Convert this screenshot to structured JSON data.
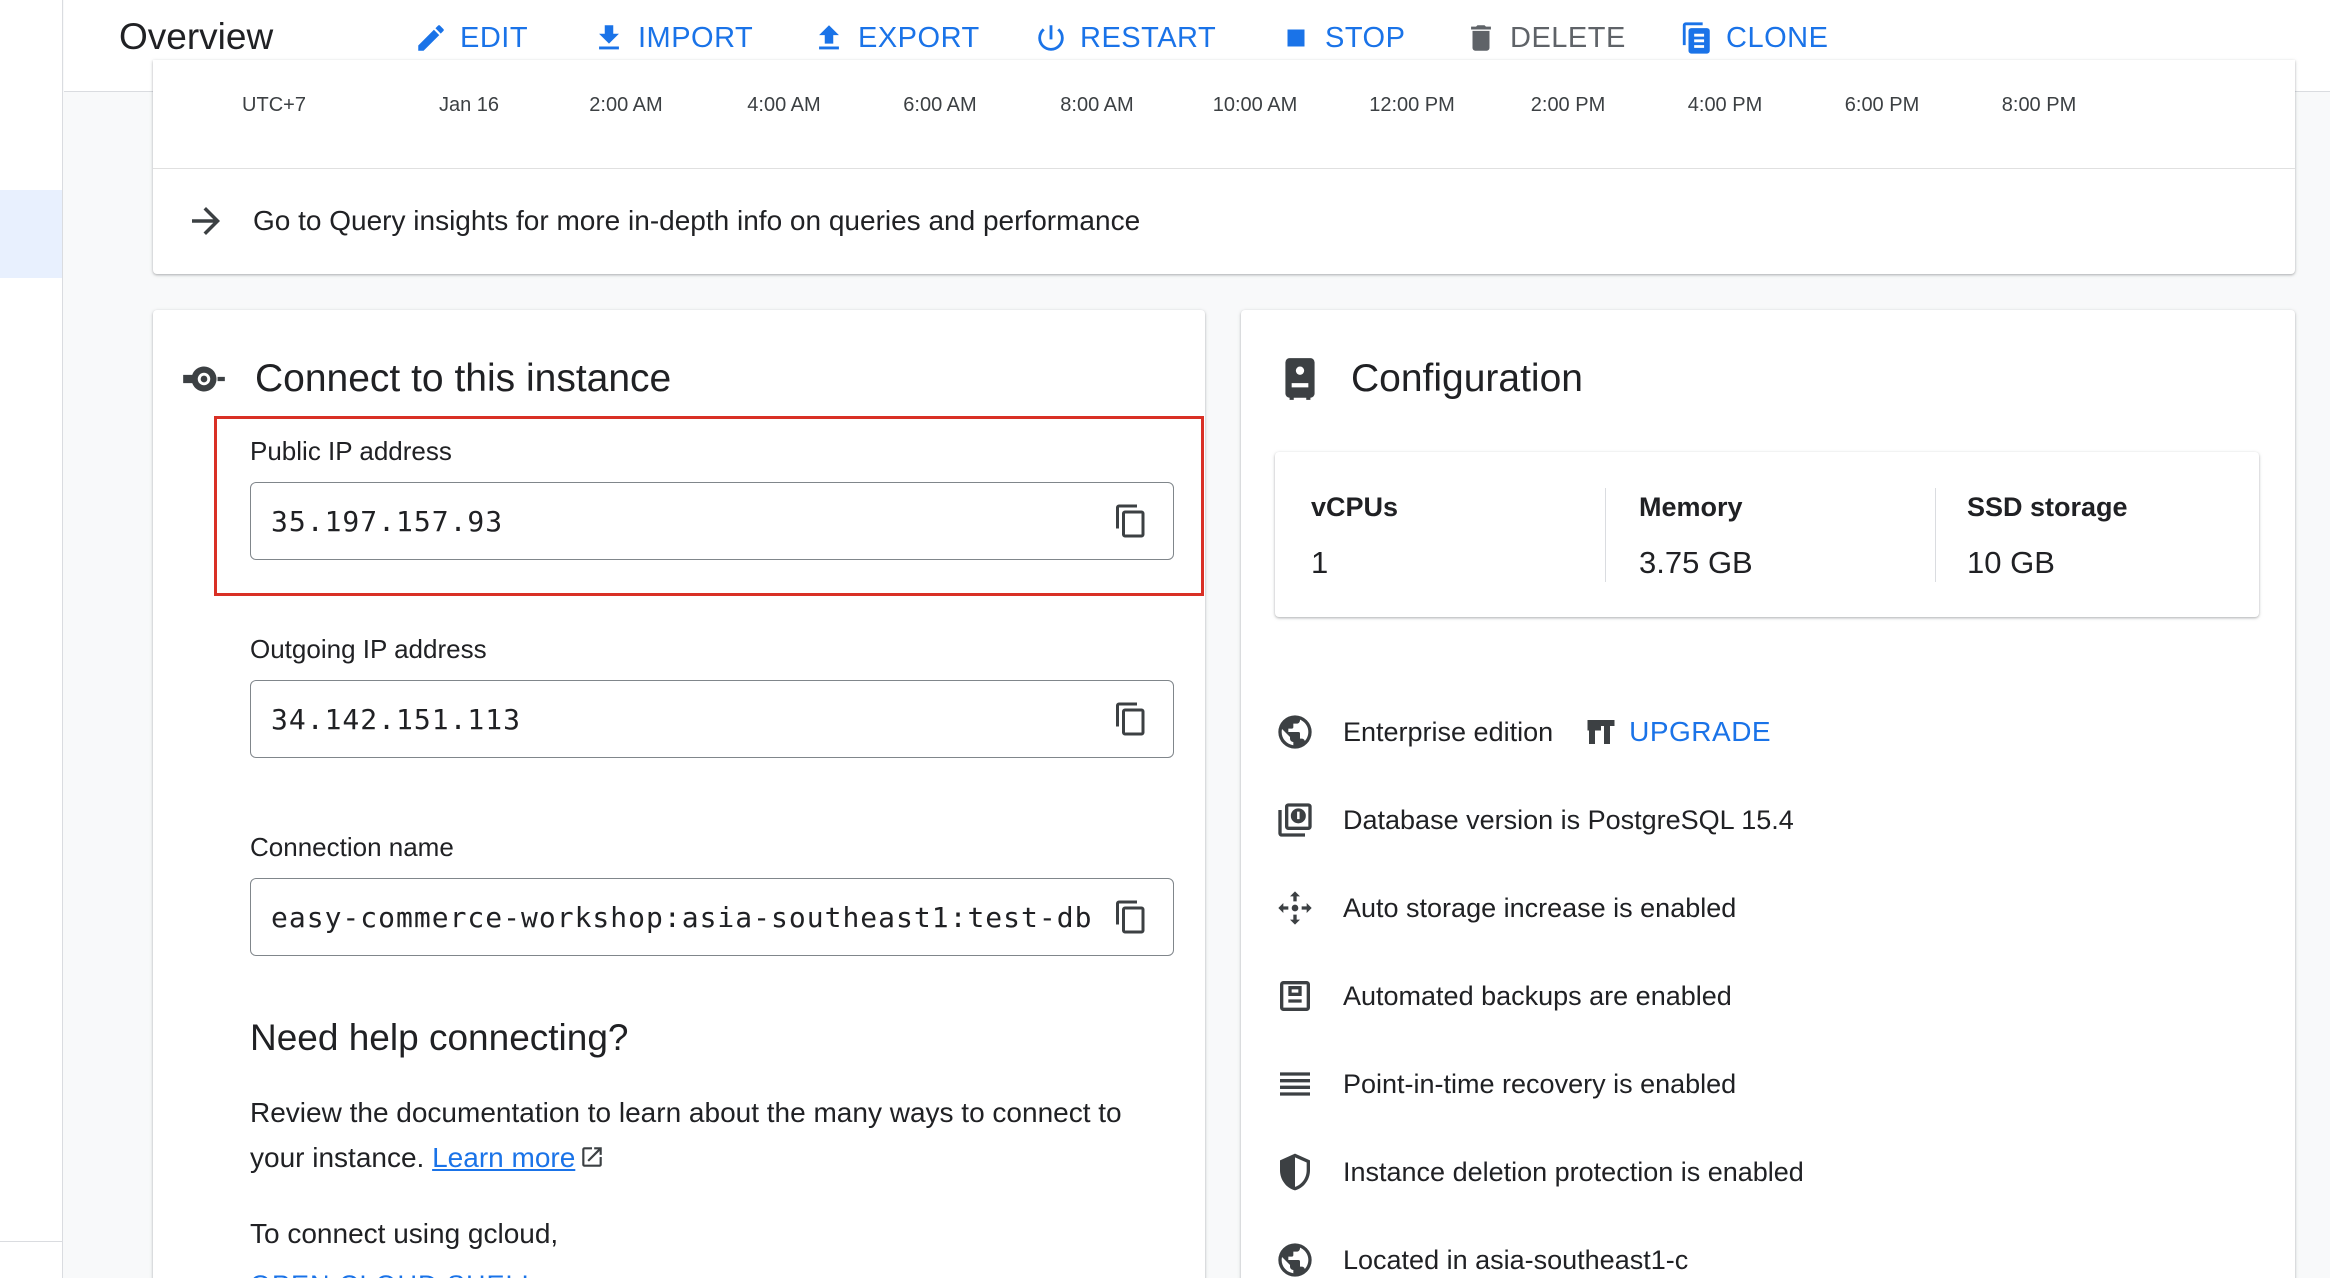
{
  "header": {
    "title": "Overview",
    "actions": [
      {
        "label": "EDIT",
        "icon": "pencil-icon",
        "enabled": true
      },
      {
        "label": "IMPORT",
        "icon": "import-icon",
        "enabled": true
      },
      {
        "label": "EXPORT",
        "icon": "export-icon",
        "enabled": true
      },
      {
        "label": "RESTART",
        "icon": "restart-icon",
        "enabled": true
      },
      {
        "label": "STOP",
        "icon": "stop-icon",
        "enabled": true
      },
      {
        "label": "DELETE",
        "icon": "trash-icon",
        "enabled": false
      },
      {
        "label": "CLONE",
        "icon": "clone-icon",
        "enabled": true
      }
    ]
  },
  "chart": {
    "ticks": [
      "UTC+7",
      "Jan 16",
      "2:00 AM",
      "4:00 AM",
      "6:00 AM",
      "8:00 AM",
      "10:00 AM",
      "12:00 PM",
      "2:00 PM",
      "4:00 PM",
      "6:00 PM",
      "8:00 PM"
    ],
    "insights_link": "Go to Query insights for more in-depth info on queries and performance"
  },
  "connect": {
    "title": "Connect to this instance",
    "public_ip_label": "Public IP address",
    "public_ip": "35.197.157.93",
    "outgoing_ip_label": "Outgoing IP address",
    "outgoing_ip": "34.142.151.113",
    "connection_name_label": "Connection name",
    "connection_name": "easy-commerce-workshop:asia-southeast1:test-db",
    "help_title": "Need help connecting?",
    "help_text": "Review the documentation to learn about the many ways to connect to your instance.",
    "learn_more": "Learn more",
    "gcloud_text": "To connect using gcloud,",
    "cloud_shell": "OPEN CLOUD SHELL"
  },
  "configuration": {
    "title": "Configuration",
    "specs": [
      {
        "label": "vCPUs",
        "value": "1"
      },
      {
        "label": "Memory",
        "value": "3.75 GB"
      },
      {
        "label": "SSD storage",
        "value": "10 GB"
      }
    ],
    "features": [
      {
        "icon": "globe-icon",
        "text": "Enterprise edition"
      },
      {
        "icon": "database-version-icon",
        "text": "Database version is PostgreSQL 15.4"
      },
      {
        "icon": "auto-storage-icon",
        "text": "Auto storage increase is enabled"
      },
      {
        "icon": "backup-icon",
        "text": "Automated backups are enabled"
      },
      {
        "icon": "list-icon",
        "text": "Point-in-time recovery is enabled"
      },
      {
        "icon": "shield-icon",
        "text": "Instance deletion protection is enabled"
      },
      {
        "icon": "globe-icon",
        "text": "Located in asia-southeast1-c"
      }
    ],
    "upgrade_label": "UPGRADE"
  },
  "colors": {
    "accent": "#1a73e8",
    "highlight": "#d93025",
    "disabled": "#5f6368"
  }
}
